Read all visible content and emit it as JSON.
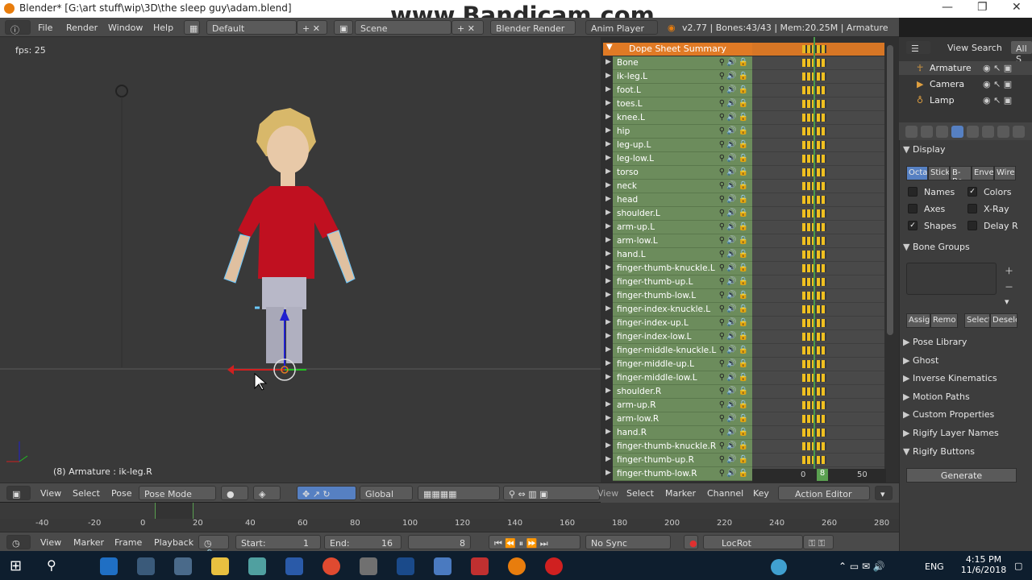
{
  "title": {
    "text": "Blender* [G:\\art stuff\\wip\\3D\\the sleep guy\\adam.blend]"
  },
  "watermark": "www.Bandicam.com",
  "topbar": {
    "menus": [
      "File",
      "Render",
      "Window",
      "Help"
    ],
    "layout": "Default",
    "scene": "Scene",
    "engine": "Blender Render",
    "anim": "Anim Player",
    "stats": "v2.77 | Bones:43/43 | Mem:20.25M | Armature"
  },
  "viewport": {
    "fps": "fps: 25",
    "info": "(8) Armature : ik-leg.R"
  },
  "vpheader": {
    "view": "View",
    "select": "Select",
    "pose": "Pose",
    "mode": "Pose Mode",
    "orient": "Global"
  },
  "dopesheet": {
    "summary": "Dope Sheet Summary",
    "bones": [
      "Bone",
      "ik-leg.L",
      "foot.L",
      "toes.L",
      "knee.L",
      "hip",
      "leg-up.L",
      "leg-low.L",
      "torso",
      "neck",
      "head",
      "shoulder.L",
      "arm-up.L",
      "arm-low.L",
      "hand.L",
      "finger-thumb-knuckle.L",
      "finger-thumb-up.L",
      "finger-thumb-low.L",
      "finger-index-knuckle.L",
      "finger-index-up.L",
      "finger-index-low.L",
      "finger-middle-knuckle.L",
      "finger-middle-up.L",
      "finger-middle-low.L",
      "shoulder.R",
      "arm-up.R",
      "arm-low.R",
      "hand.R",
      "finger-thumb-knuckle.R",
      "finger-thumb-up.R",
      "finger-thumb-low.R"
    ],
    "ruler": [
      "0",
      "50"
    ],
    "frame": "8"
  },
  "dsheader": {
    "view": "View",
    "select": "Select",
    "marker": "Marker",
    "channel": "Channel",
    "key": "Key",
    "editor": "Action Editor"
  },
  "timeline": {
    "ticks": [
      "-40",
      "-20",
      "0",
      "20",
      "40",
      "60",
      "80",
      "100",
      "120",
      "140",
      "160",
      "180",
      "200",
      "220",
      "240",
      "260",
      "280"
    ]
  },
  "tlheader": {
    "view": "View",
    "marker": "Marker",
    "frame": "Frame",
    "playback": "Playback",
    "start_label": "Start:",
    "start": "1",
    "end_label": "End:",
    "end": "16",
    "current": "8",
    "sync": "No Sync",
    "keyset": "LocRot"
  },
  "outliner": {
    "view": "View",
    "search": "Search",
    "all": "All S",
    "items": [
      "Armature",
      "Camera",
      "Lamp"
    ]
  },
  "props": {
    "display": "Display",
    "types": [
      "Octa",
      "Stick",
      "B-Bo",
      "Envel",
      "Wire"
    ],
    "names": "Names",
    "colors": "Colors",
    "axes": "Axes",
    "xray": "X-Ray",
    "shapes": "Shapes",
    "delay": "Delay R",
    "bone_groups": "Bone Groups",
    "assign": "Assign",
    "remove": "Remo",
    "select": "Select",
    "deselect": "Desele",
    "sections": [
      "Pose Library",
      "Ghost",
      "Inverse Kinematics",
      "Motion Paths",
      "Custom Properties",
      "Rigify Layer Names",
      "Rigify Buttons"
    ],
    "generate": "Generate"
  },
  "taskbar": {
    "lang": "ENG",
    "time": "4:15 PM",
    "date": "11/6/2018"
  }
}
